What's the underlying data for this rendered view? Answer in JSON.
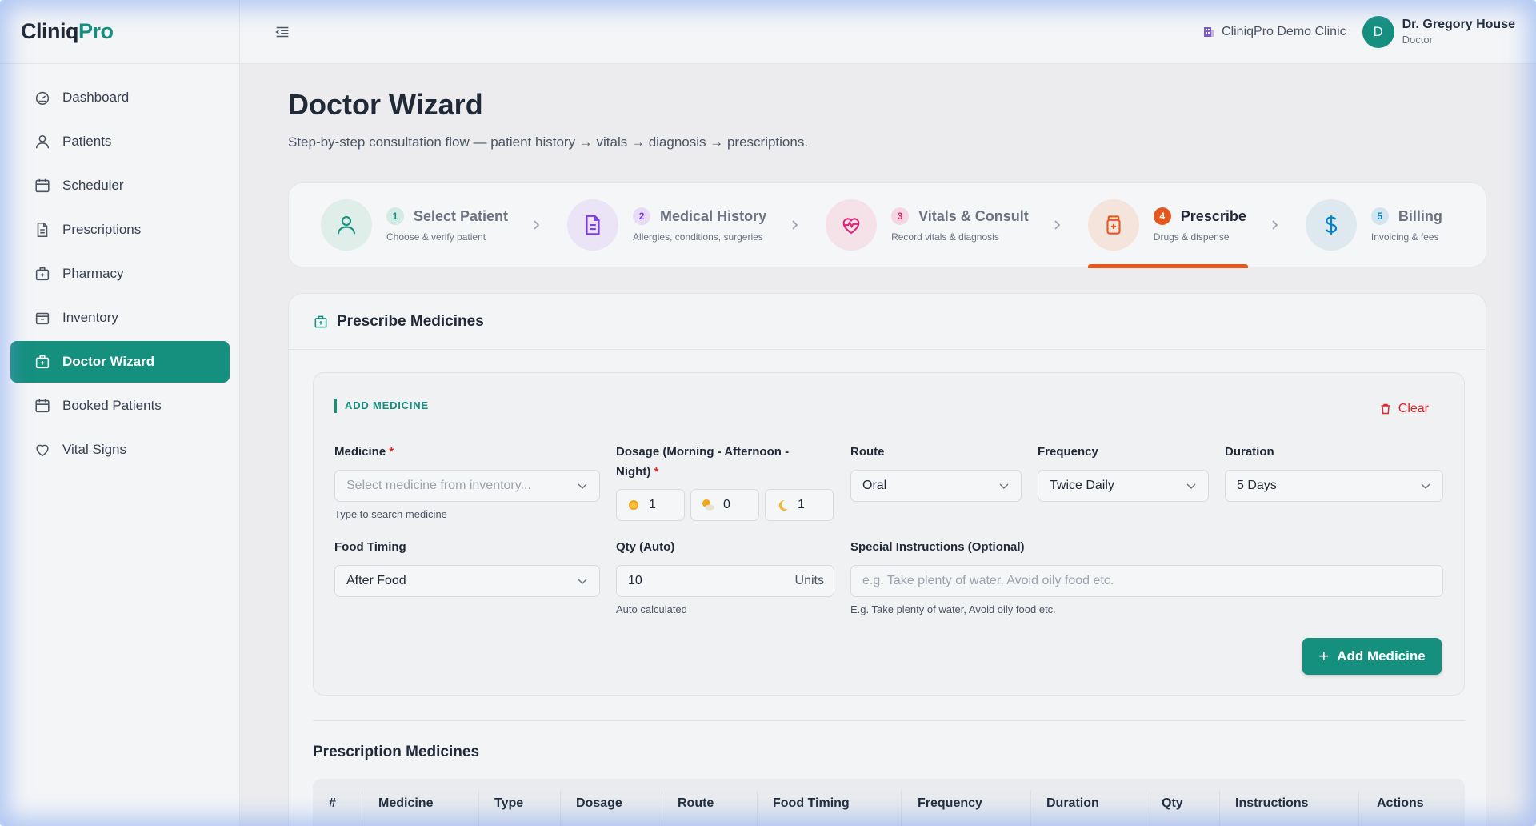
{
  "app": {
    "logo_part1": "Cliniq",
    "logo_part2": "Pro"
  },
  "sidebar": {
    "items": [
      {
        "label": "Dashboard",
        "icon": "dashboard-icon"
      },
      {
        "label": "Patients",
        "icon": "user-icon"
      },
      {
        "label": "Scheduler",
        "icon": "calendar-icon"
      },
      {
        "label": "Prescriptions",
        "icon": "document-icon"
      },
      {
        "label": "Pharmacy",
        "icon": "medkit-icon"
      },
      {
        "label": "Inventory",
        "icon": "box-icon"
      },
      {
        "label": "Doctor Wizard",
        "icon": "medkit-icon",
        "active": true
      },
      {
        "label": "Booked Patients",
        "icon": "calendar-icon"
      },
      {
        "label": "Vital Signs",
        "icon": "heart-icon"
      }
    ]
  },
  "topbar": {
    "clinic_name": "CliniqPro Demo Clinic",
    "avatar_initial": "D",
    "user_name": "Dr. Gregory House",
    "user_role": "Doctor"
  },
  "page": {
    "title": "Doctor Wizard",
    "subtitle": "Step-by-step consultation flow — patient history → vitals → diagnosis → prescriptions."
  },
  "steps": [
    {
      "num": "1",
      "title": "Select Patient",
      "desc": "Choose & verify patient",
      "icon": "user-icon"
    },
    {
      "num": "2",
      "title": "Medical History",
      "desc": "Allergies, conditions, surgeries",
      "icon": "document-icon"
    },
    {
      "num": "3",
      "title": "Vitals & Consult",
      "desc": "Record vitals & diagnosis",
      "icon": "heartbeat-icon"
    },
    {
      "num": "4",
      "title": "Prescribe",
      "desc": "Drugs & dispense",
      "icon": "pill-bottle-icon",
      "active": true
    },
    {
      "num": "5",
      "title": "Billing",
      "desc": "Invoicing & fees",
      "icon": "dollar-icon"
    }
  ],
  "prescribe": {
    "card_title": "Prescribe Medicines",
    "add_title": "ADD MEDICINE",
    "clear_label": "Clear",
    "medicine_label": "Medicine",
    "required_mark": "*",
    "medicine_placeholder": "Select medicine from inventory...",
    "medicine_hint": "Type to search medicine",
    "dosage_label_line1": "Dosage (Morning - Afternoon -",
    "dosage_label_line2": "Night)",
    "dosage": {
      "morning": "1",
      "afternoon": "0",
      "night": "1"
    },
    "route_label": "Route",
    "route_value": "Oral",
    "frequency_label": "Frequency",
    "frequency_value": "Twice Daily",
    "duration_label": "Duration",
    "duration_value": "5 Days",
    "food_label": "Food Timing",
    "food_value": "After Food",
    "qty_label": "Qty (Auto)",
    "qty_value": "10",
    "qty_unit": "Units",
    "qty_hint": "Auto calculated",
    "instructions_label": "Special Instructions (Optional)",
    "instructions_placeholder": "e.g. Take plenty of water, Avoid oily food etc.",
    "instructions_hint": "E.g. Take plenty of water, Avoid oily food etc.",
    "add_button": "Add Medicine"
  },
  "table": {
    "title": "Prescription Medicines",
    "columns": [
      "#",
      "Medicine",
      "Type",
      "Dosage",
      "Route",
      "Food Timing",
      "Frequency",
      "Duration",
      "Qty",
      "Instructions",
      "Actions"
    ]
  },
  "colors": {
    "brand": "#158f7e",
    "accent_active_step": "#e2581e",
    "danger": "#dc2626"
  }
}
